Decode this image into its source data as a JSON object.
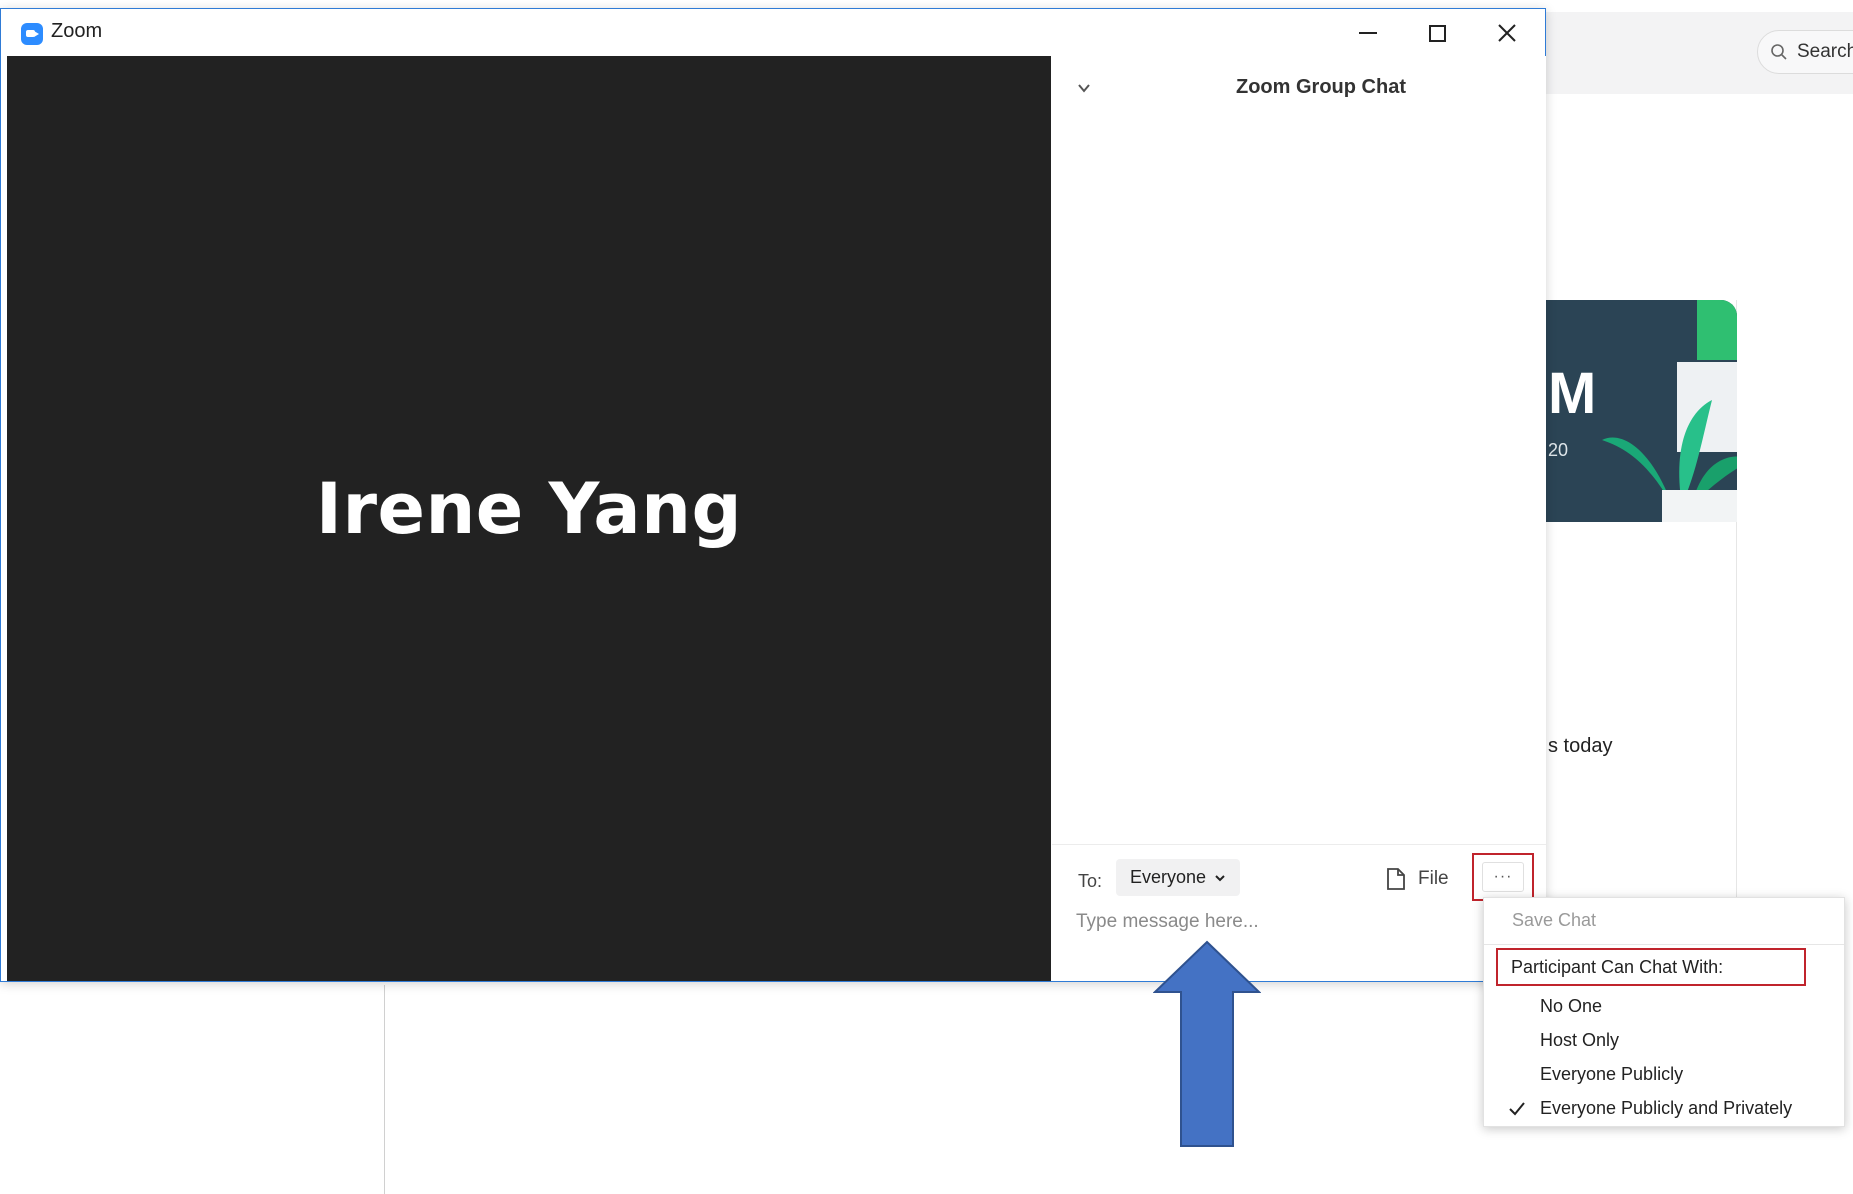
{
  "window": {
    "title": "Zoom"
  },
  "video": {
    "participant_name": "Irene Yang"
  },
  "chat": {
    "title": "Zoom Group Chat",
    "to_label": "To:",
    "recipient": "Everyone",
    "file_label": "File",
    "more_label": "···",
    "message_placeholder": "Type message here..."
  },
  "menu": {
    "save_chat": "Save Chat",
    "heading": "Participant Can Chat With:",
    "options": [
      {
        "label": "No One",
        "checked": false
      },
      {
        "label": "Host Only",
        "checked": false
      },
      {
        "label": "Everyone Publicly",
        "checked": false
      },
      {
        "label": "Everyone Publicly and Privately",
        "checked": true
      }
    ]
  },
  "background": {
    "search_label": "Search",
    "banner_title": "M",
    "banner_subtitle": "20",
    "partial_text": "s today"
  },
  "colors": {
    "highlight_box": "#c0242c",
    "arrow": "#4472c4",
    "video_bg": "#222222",
    "zoom_blue": "#2d8cff"
  }
}
